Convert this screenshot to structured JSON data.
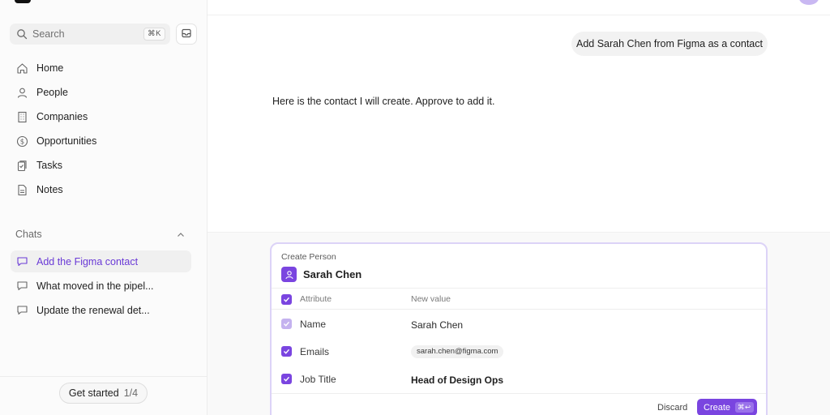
{
  "sidebar": {
    "search": {
      "label": "Search",
      "shortcut": "⌘K"
    },
    "nav": [
      {
        "label": "Home",
        "icon": "home-icon"
      },
      {
        "label": "People",
        "icon": "person-icon"
      },
      {
        "label": "Companies",
        "icon": "building-icon"
      },
      {
        "label": "Opportunities",
        "icon": "dollar-icon"
      },
      {
        "label": "Tasks",
        "icon": "clipboard-icon"
      },
      {
        "label": "Notes",
        "icon": "note-icon"
      }
    ],
    "chats_header": "Chats",
    "chats": [
      {
        "label": "Add the Figma contact",
        "active": true
      },
      {
        "label": "What moved in the pipel...",
        "active": false
      },
      {
        "label": "Update the renewal det...",
        "active": false
      }
    ],
    "get_started": {
      "label": "Get started",
      "count": "1/4"
    }
  },
  "chat": {
    "user_message": "Add Sarah Chen from Figma as a contact",
    "assistant_message": "Here is the contact I will create. Approve to add it."
  },
  "card": {
    "subtitle": "Create Person",
    "title": "Sarah Chen",
    "header": {
      "attribute": "Attribute",
      "value": "New value"
    },
    "rows": [
      {
        "attribute": "Name",
        "value": "Sarah Chen",
        "checked": true,
        "muted": true
      },
      {
        "attribute": "Emails",
        "value": "sarah.chen@figma.com",
        "checked": true,
        "muted": false
      },
      {
        "attribute": "Job Title",
        "value": "Head of Design Ops",
        "checked": true,
        "muted": false
      }
    ],
    "discard_label": "Discard",
    "create_label": "Create",
    "create_shortcut": "⌘↩"
  },
  "colors": {
    "accent": "#7a45e0",
    "accent_light": "#dcd3f7"
  }
}
